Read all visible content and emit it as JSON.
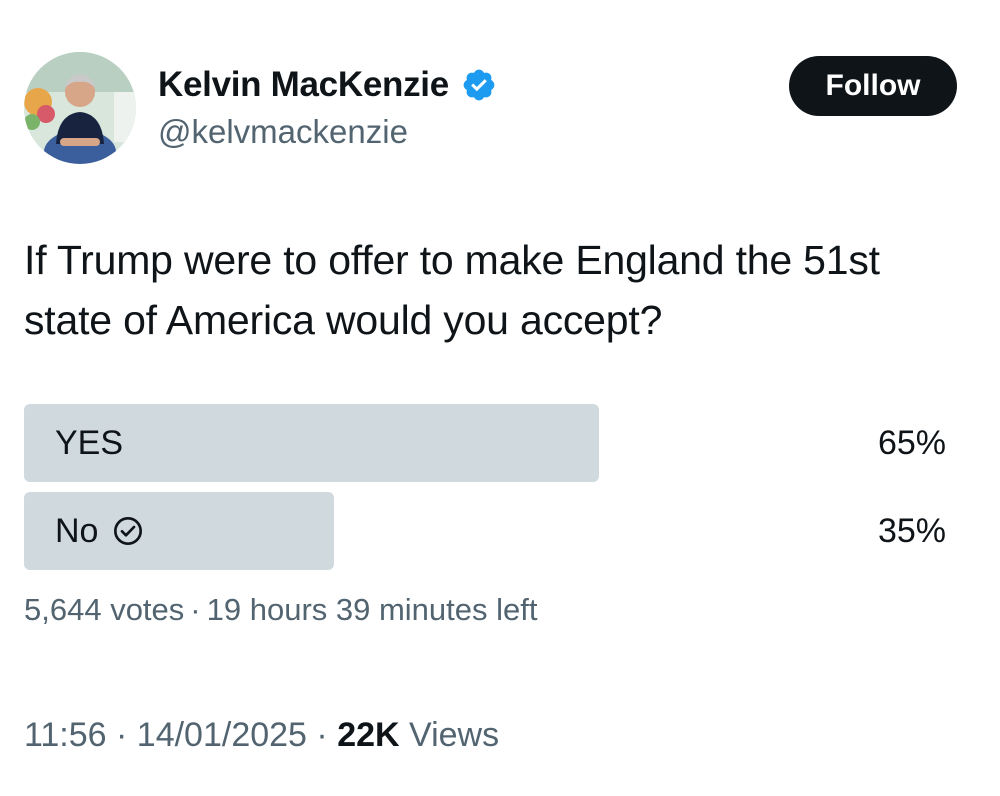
{
  "author": {
    "display_name": "Kelvin MacKenzie",
    "handle": "@kelvmackenzie",
    "verified": true,
    "verified_color": "#1d9bf0"
  },
  "follow_label": "Follow",
  "tweet": {
    "text": "If Trump were to offer to make England the 51st state of America would you accept?"
  },
  "poll": {
    "options": [
      {
        "label": "YES",
        "percent_text": "65%",
        "percent": 65,
        "selected": false
      },
      {
        "label": "No",
        "percent_text": "35%",
        "percent": 35,
        "selected": true
      }
    ],
    "votes": "5,644 votes",
    "separator": "·",
    "time_left": "19 hours 39 minutes left",
    "bar_color": "#cfd9de"
  },
  "footer": {
    "time": "11:56",
    "date": "14/01/2025",
    "separator": "·",
    "views_count": "22K",
    "views_label": "Views"
  },
  "icons": {
    "verified": "verified-badge-icon",
    "selected_option": "check-circle-icon"
  }
}
